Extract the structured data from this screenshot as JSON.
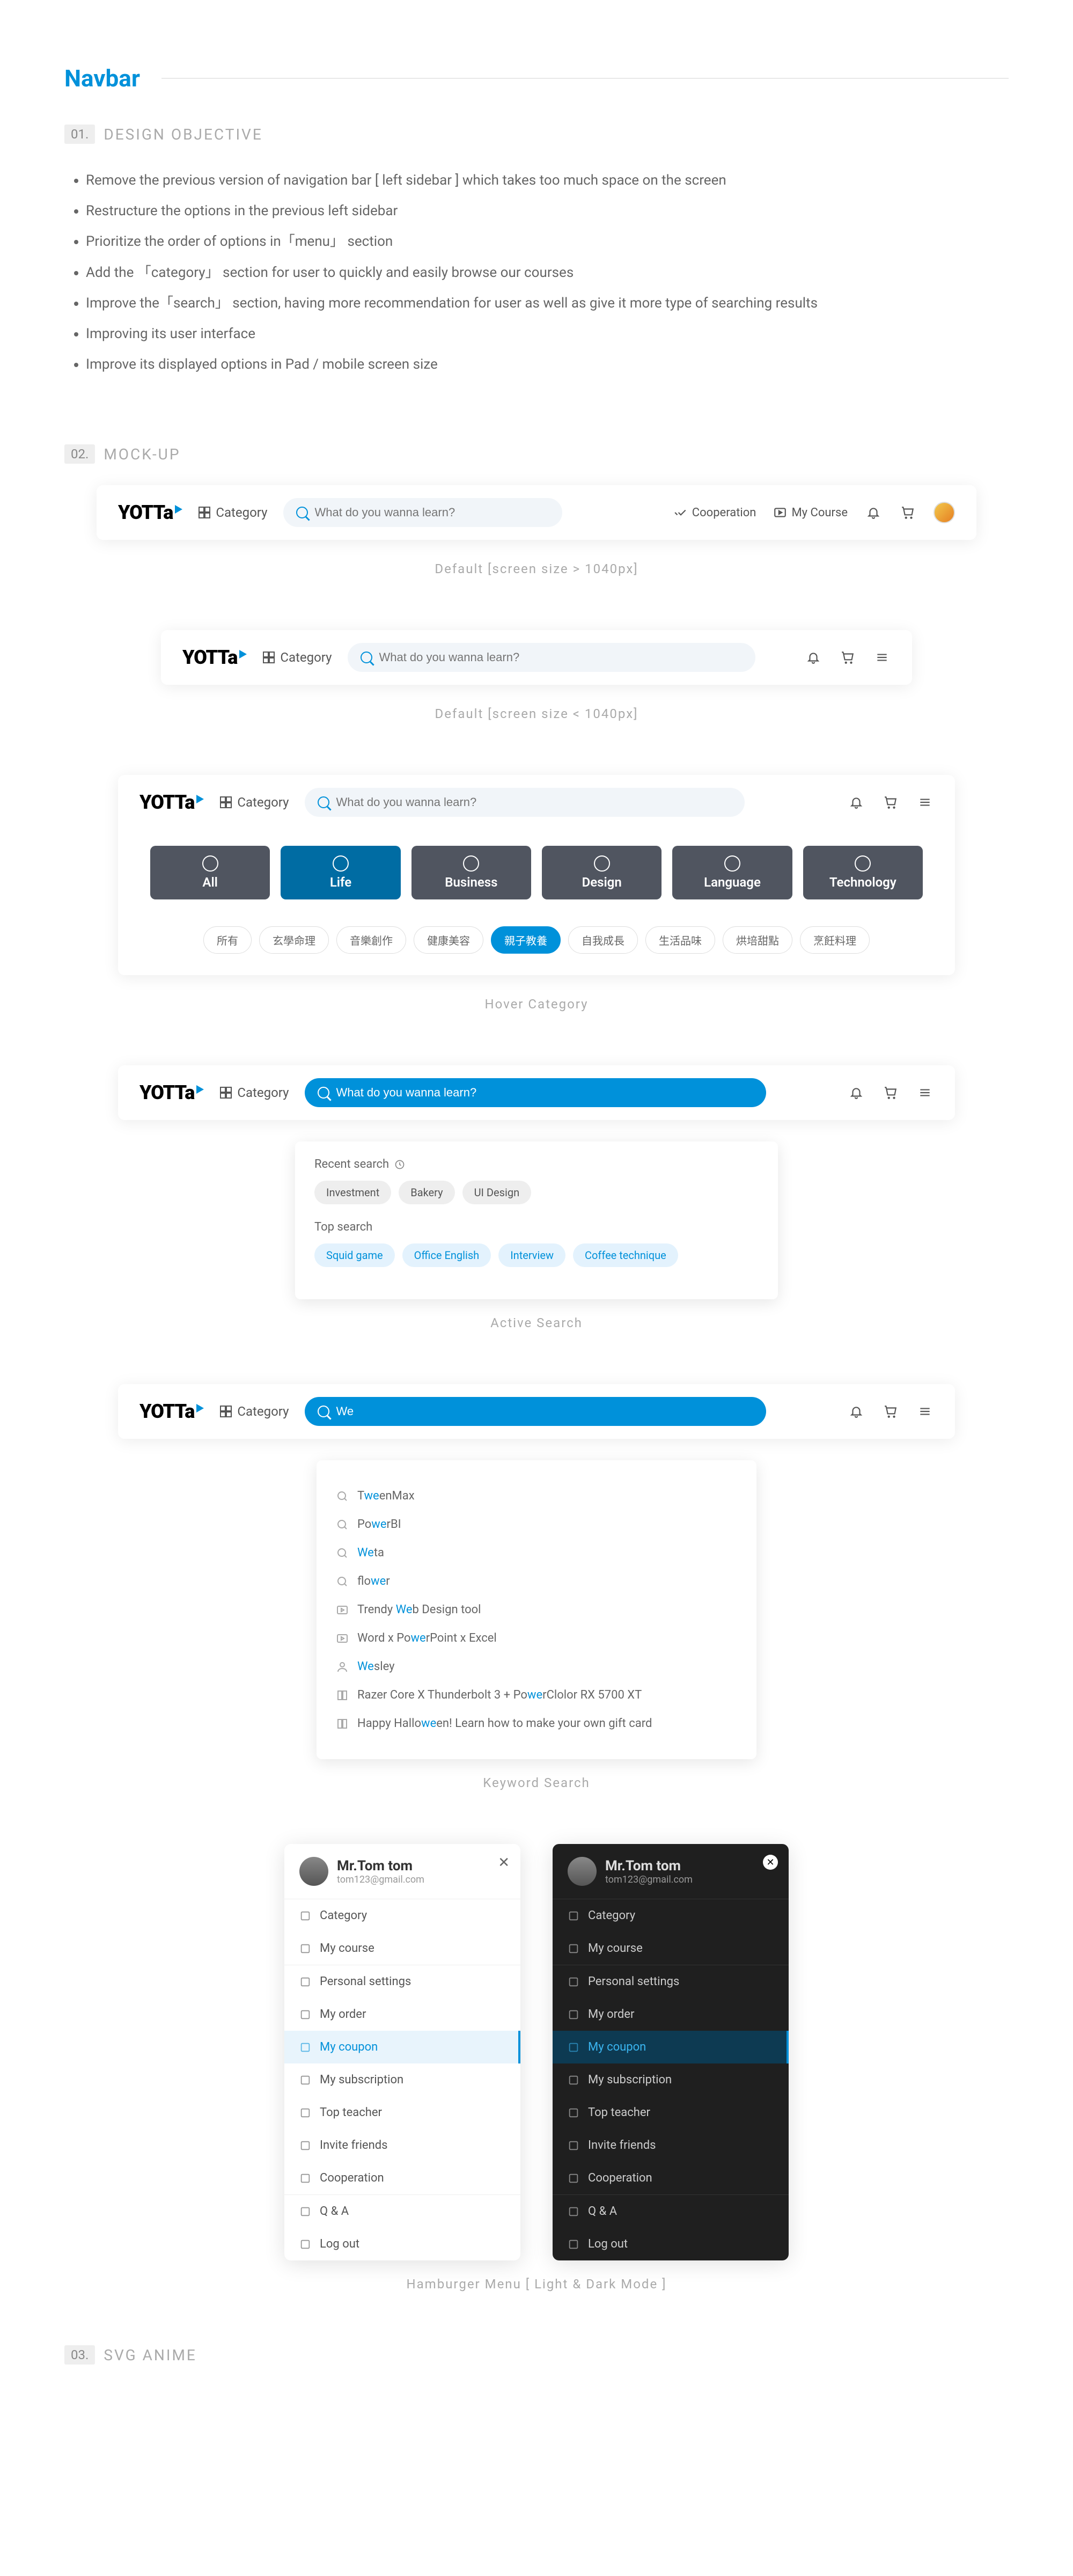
{
  "page": {
    "title": "Navbar"
  },
  "sections": {
    "s1": {
      "num": "01.",
      "title": "DESIGN OBJECTIVE"
    },
    "s2": {
      "num": "02.",
      "title": "MOCK-UP"
    },
    "s3": {
      "num": "03.",
      "title": "SVG ANIME"
    }
  },
  "objectives": [
    "Remove the previous version of navigation bar [ left sidebar ] which takes too much space on the screen",
    "Restructure the options in the previous left sidebar",
    "Prioritize the order of options in「menu」 section",
    "Add the 「category」 section for user to quickly and easily browse our courses",
    "Improve the「search」 section, having more recommendation for user as well as give it more type of searching results",
    "Improving its user interface",
    "Improve its displayed options in Pad / mobile screen size"
  ],
  "nav": {
    "logo": "YOTTa",
    "category": "Category",
    "search_ph": "What do you wanna learn?",
    "cooperation": "Cooperation",
    "mycourse": "My Course"
  },
  "captions": {
    "c1": "Default [screen size > 1040px]",
    "c2": "Default  [screen size < 1040px]",
    "c3": "Hover Category",
    "c4": "Active Search",
    "c5": "Keyword Search",
    "c6": "Hamburger Menu [ Light & Dark Mode ]"
  },
  "categories": [
    "All",
    "Life",
    "Business",
    "Design",
    "Language",
    "Technology"
  ],
  "subcats": [
    "所有",
    "玄學命理",
    "音樂創作",
    "健康美容",
    "親子教養",
    "自我成長",
    "生活品味",
    "烘培甜點",
    "烹飪料理"
  ],
  "recent": {
    "label": "Recent search",
    "items": [
      "Investment",
      "Bakery",
      "UI Design"
    ]
  },
  "top": {
    "label": "Top search",
    "items": [
      "Squid game",
      "Office English",
      "Interview",
      "Coffee technique"
    ]
  },
  "kw": {
    "query": "We"
  },
  "suggestions": [
    {
      "pre": "T",
      "hl": "we",
      "post": "enMax",
      "icon": "search"
    },
    {
      "pre": "Po",
      "hl": "we",
      "post": "rBI",
      "icon": "search"
    },
    {
      "pre": "",
      "hl": "We",
      "post": "ta",
      "icon": "search"
    },
    {
      "pre": "flo",
      "hl": "we",
      "post": "r",
      "icon": "search"
    },
    {
      "pre": "Trendy ",
      "hl": "We",
      "post": "b Design tool",
      "icon": "play"
    },
    {
      "pre": "Word x Po",
      "hl": "we",
      "post": "rPoint x Excel",
      "icon": "play"
    },
    {
      "pre": "",
      "hl": "We",
      "post": "sley",
      "icon": "user"
    },
    {
      "pre": "Razer Core X Thunderbolt 3 + Po",
      "hl": "we",
      "post": "rClolor RX 5700 XT",
      "icon": "book"
    },
    {
      "pre": "Happy Hallo",
      "hl": "we",
      "post": "en! Learn how to make your own gift card",
      "icon": "book"
    }
  ],
  "menu": {
    "name": "Mr.Tom tom",
    "email": "tom123@gmail.com",
    "groups": [
      [
        "Category",
        "My course"
      ],
      [
        "Personal settings",
        "My order",
        "My coupon",
        "My subscription",
        "Top teacher",
        "Invite friends",
        "Cooperation"
      ],
      [
        "Q & A",
        "Log out"
      ]
    ],
    "active": "My coupon"
  }
}
